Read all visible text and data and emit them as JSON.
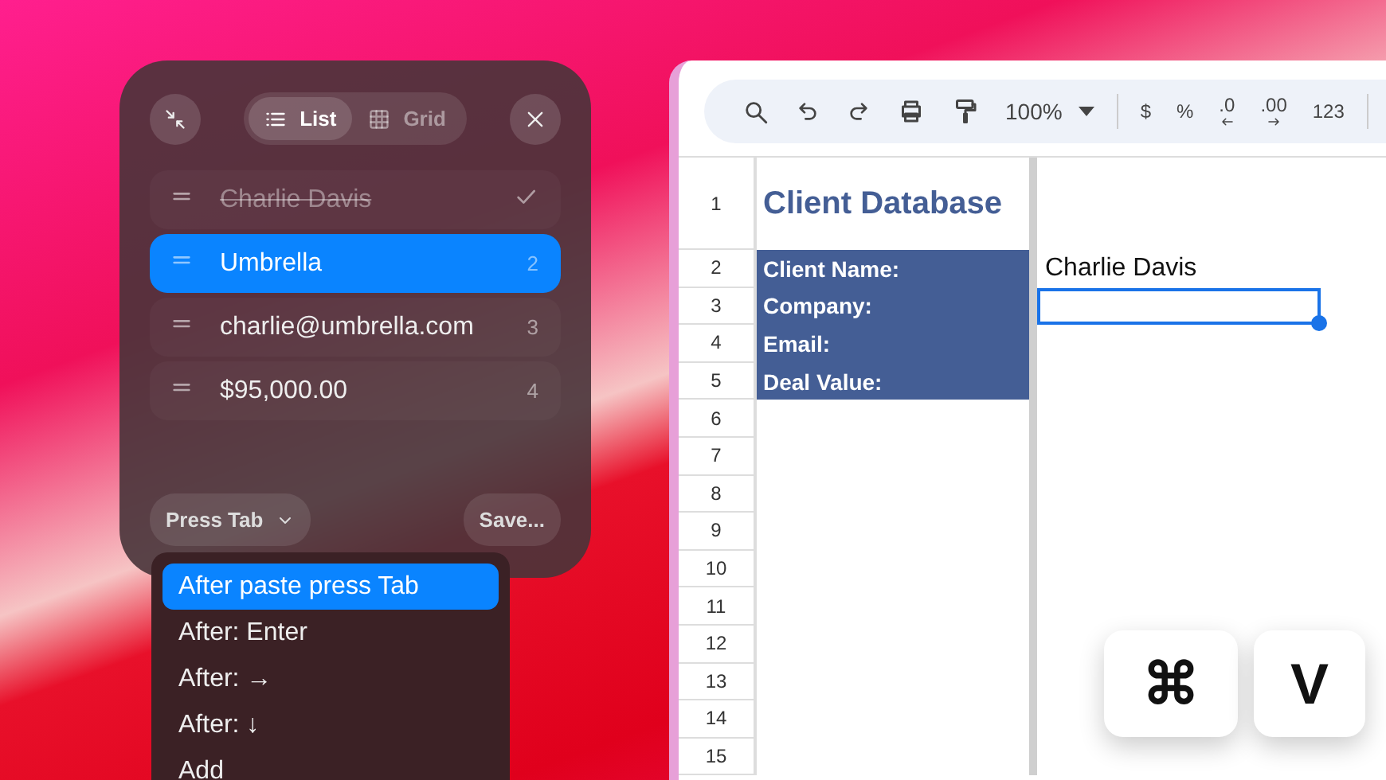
{
  "panel": {
    "view_tabs": [
      {
        "label": "List",
        "kind": "list",
        "selected": true
      },
      {
        "label": "Grid",
        "kind": "grid",
        "selected": false
      }
    ],
    "items": [
      {
        "text": "Charlie Davis",
        "done": true,
        "selected": false
      },
      {
        "text": "Umbrella",
        "number": "2",
        "done": false,
        "selected": true
      },
      {
        "text": "charlie@umbrella.com",
        "number": "3",
        "done": false,
        "selected": false
      },
      {
        "text": "$95,000.00",
        "number": "4",
        "done": false,
        "selected": false
      }
    ],
    "mode_button": "Press Tab",
    "save_button": "Save..."
  },
  "menu": {
    "items": [
      {
        "label": "After paste press Tab",
        "selected": true
      },
      {
        "label": "After: Enter",
        "selected": false
      },
      {
        "label": "After: →",
        "selected": false
      },
      {
        "label": "After: ↓",
        "selected": false
      },
      {
        "label": "Add",
        "selected": false
      }
    ]
  },
  "toolbar": {
    "zoom": "100%",
    "buttons": [
      {
        "label": "$",
        "kind": "plain"
      },
      {
        "label": "%",
        "kind": "plain"
      },
      {
        "label": ".0",
        "kind": "arrow-left"
      },
      {
        "label": ".00",
        "kind": "arrow-right"
      },
      {
        "label": "123",
        "kind": "plain"
      }
    ]
  },
  "sheet": {
    "rows": [
      {
        "number": "1",
        "kind": "title",
        "label": "Client Database",
        "selected": false
      },
      {
        "number": "2",
        "kind": "field",
        "label": "Client Name:",
        "value": "Charlie Davis",
        "selected": false
      },
      {
        "number": "3",
        "kind": "field",
        "label": "Company:",
        "selected": true
      },
      {
        "number": "4",
        "kind": "field",
        "label": "Email:",
        "selected": false
      },
      {
        "number": "5",
        "kind": "field",
        "label": "Deal Value:",
        "selected": false
      },
      {
        "number": "6",
        "kind": "empty",
        "selected": false
      },
      {
        "number": "7",
        "kind": "empty",
        "selected": false
      },
      {
        "number": "8",
        "kind": "empty",
        "selected": false
      },
      {
        "number": "9",
        "kind": "empty",
        "selected": false
      },
      {
        "number": "10",
        "kind": "empty",
        "selected": false
      },
      {
        "number": "11",
        "kind": "empty",
        "selected": false
      },
      {
        "number": "12",
        "kind": "empty",
        "selected": false
      },
      {
        "number": "13",
        "kind": "empty",
        "selected": false
      },
      {
        "number": "14",
        "kind": "empty",
        "selected": false
      },
      {
        "number": "15",
        "kind": "empty",
        "selected": false
      }
    ]
  },
  "keys": [
    "⌘",
    "V"
  ]
}
